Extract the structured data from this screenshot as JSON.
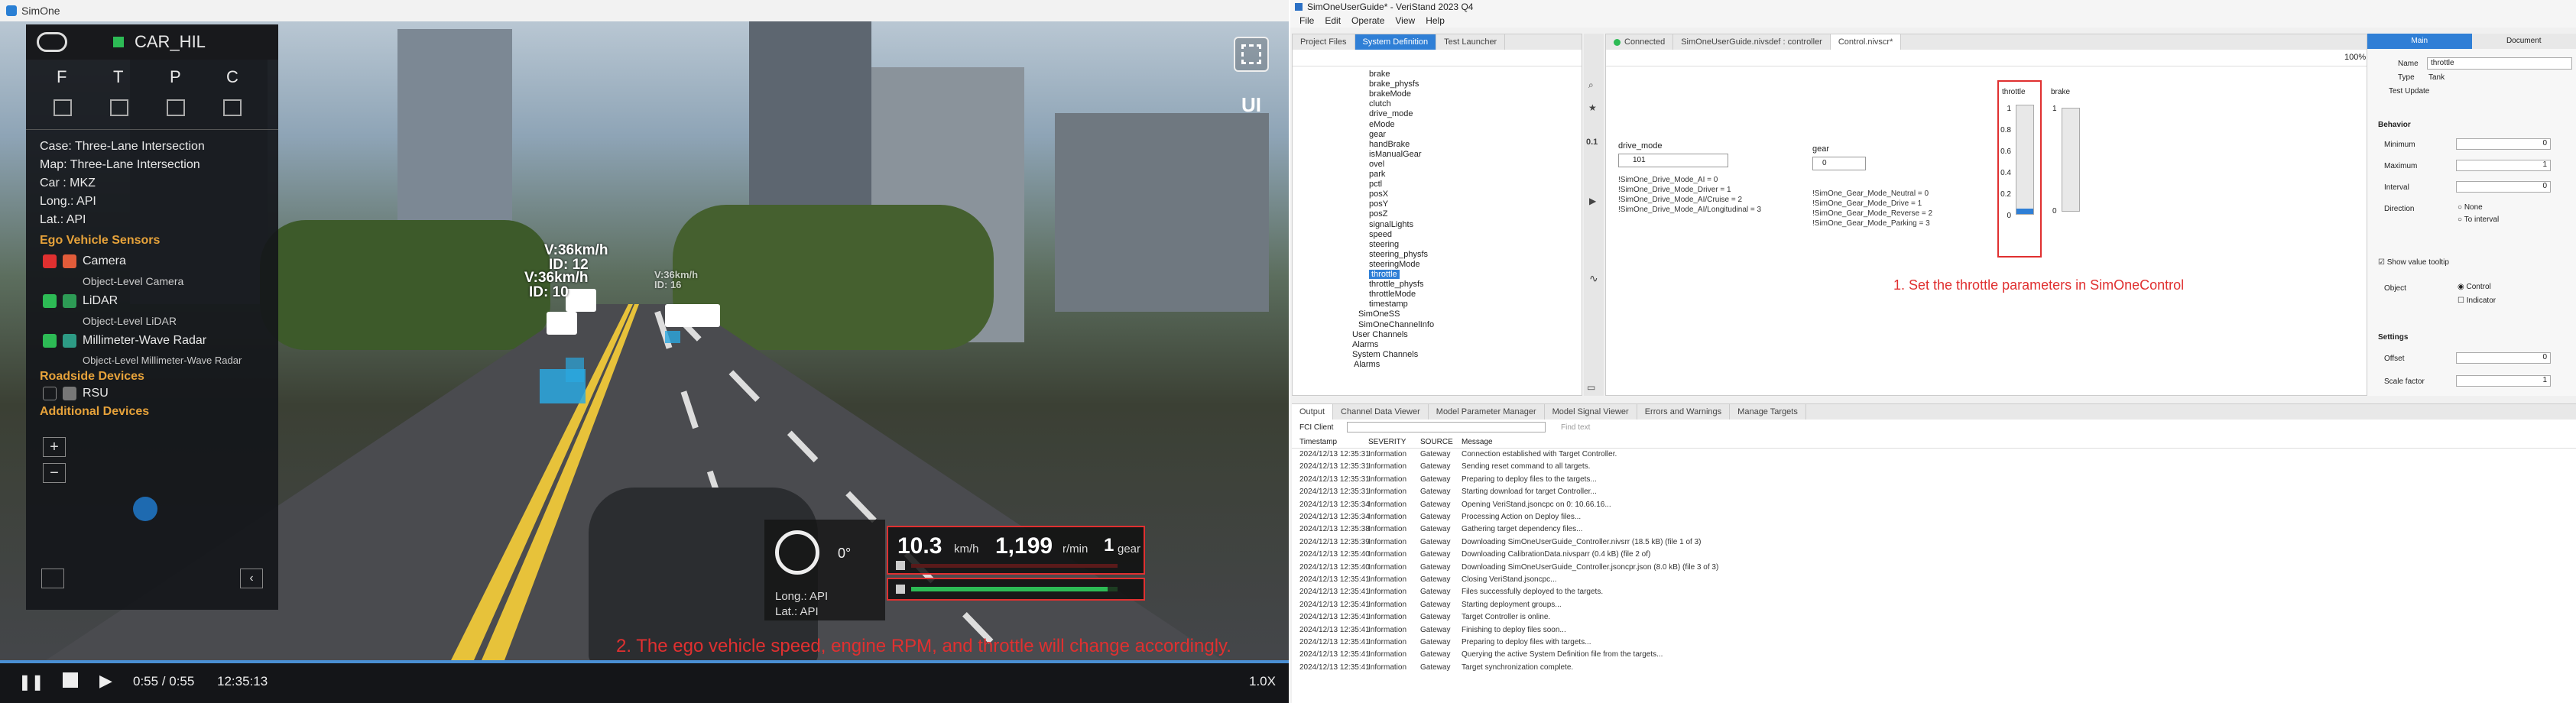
{
  "simone": {
    "app_title": "SimOne",
    "vehicle_name": "CAR_HIL",
    "modes": [
      "F",
      "T",
      "P",
      "C"
    ],
    "info": [
      {
        "key": "Case:",
        "value": "Three-Lane Intersection"
      },
      {
        "key": "Map:",
        "value": "Three-Lane Intersection"
      },
      {
        "key": "Car :",
        "value": "MKZ"
      },
      {
        "key": "Long.:",
        "value": "API"
      },
      {
        "key": "Lat.:",
        "value": "API"
      }
    ],
    "sections": {
      "ego": "Ego Vehicle Sensors",
      "roadside": "Roadside Devices",
      "additional": "Additional Devices"
    },
    "sensors": [
      {
        "name": "Camera",
        "sub": "Object-Level Camera"
      },
      {
        "name": "LiDAR",
        "sub": "Object-Level LiDAR"
      },
      {
        "name": "Millimeter-Wave Radar",
        "sub": "Object-Level Millimeter-Wave Radar"
      }
    ],
    "roadside_item": "RSU",
    "right_btn_ui": "UI",
    "car_labels": [
      {
        "line1": "V:36km/h",
        "line2": "ID: 12"
      },
      {
        "line1": "V:36km/h",
        "line2": "ID: 10"
      },
      {
        "line1": "V:36km/h",
        "line2": "ID: 16"
      }
    ],
    "dash": {
      "steer": "0°",
      "speed": "10.3",
      "speed_unit": "km/h",
      "rpm": "1,199",
      "rpm_unit": "r/min",
      "gear": "1",
      "gear_unit": "gear",
      "long": "Long.: API",
      "lat": "Lat.: API",
      "throttle_level": 0.95
    },
    "annotation": "2. The ego vehicle speed, engine RPM, and throttle will change accordingly.",
    "time": "0:55 / 0:55",
    "clock": "12:35:13",
    "speed_factor": "1.0X",
    "progress": 1.0,
    "colors": {
      "accent": "#e03030",
      "green": "#2dbb55",
      "box": "#2aa8e0"
    }
  },
  "veristand": {
    "title": "SimOneUserGuide* - VeriStand 2023 Q4",
    "menu": [
      "File",
      "Edit",
      "Operate",
      "View",
      "Help"
    ],
    "left_tabs": [
      "Project Files",
      "System Definition",
      "Test Launcher"
    ],
    "status_tabs": [
      "Connected",
      "SimOneUserGuide.nivsdef : controller",
      "Control.nivscr*"
    ],
    "zoom": "100%",
    "tree": [
      "brake",
      "brake_physfs",
      "brakeMode",
      "clutch",
      "drive_mode",
      "eMode",
      "gear",
      "handBrake",
      "isManualGear",
      "ovel",
      "park",
      "pctl",
      "posX",
      "posY",
      "posZ",
      "signalLights",
      "speed",
      "steering",
      "steering_physfs",
      "steeringMode",
      "throttle",
      "throttle_physfs",
      "throttleMode",
      "timestamp",
      "SimOneSS",
      "SimOneChannelInfo",
      "User Channels",
      "Alarms",
      "System Channels",
      "Alarms"
    ],
    "drive_mode_label": "drive_mode",
    "drive_mode_value": "101",
    "drive_mode_notes": [
      "!SimOne_Drive_Mode_AI = 0",
      "!SimOne_Drive_Mode_Driver = 1",
      "!SimOne_Drive_Mode_AI/Cruise = 2",
      "!SimOne_Drive_Mode_AI/Longitudinal = 3"
    ],
    "gear_label": "gear",
    "gear_value": "0",
    "gear_notes": [
      "!SimOne_Gear_Mode_Neutral = 0",
      "!SimOne_Gear_Mode_Drive = 1",
      "!SimOne_Gear_Mode_Reverse = 2",
      "!SimOne_Gear_Mode_Parking = 3"
    ],
    "throttle_label": "throttle",
    "brake_label": "brake",
    "ticks": [
      "1",
      "0.8",
      "0.6",
      "0.4",
      "0.2",
      "0"
    ],
    "brake_ticks": [
      "1",
      "0"
    ],
    "throttle_value": 0.05,
    "instruction": "1. Set the throttle parameters in SimOneControl",
    "props": {
      "tabs": [
        "Main",
        "Document"
      ],
      "name_label": "Name",
      "name_value": "throttle",
      "type_label": "Type",
      "type_value": "Tank",
      "test_update": "Test Update",
      "behavior": "Behavior",
      "minimum": "Minimum",
      "min_value": "0",
      "maximum": "Maximum",
      "max_value": "1",
      "interval": "Interval",
      "interval_value": "0",
      "direction": "Direction",
      "dir_none": "None",
      "dir_to": "To interval",
      "show_tooltip": "Show value tooltip",
      "object": "Object",
      "obj_control": "Control",
      "obj_indicator": "Indicator",
      "settings": "Settings",
      "offset": "Offset",
      "offset_value": "0",
      "scale": "Scale factor",
      "scale_value": "1"
    },
    "bottom_tabs": [
      "Output",
      "Channel Data Viewer",
      "Model Parameter Manager",
      "Model Signal Viewer",
      "Errors and Warnings",
      "Manage Targets"
    ],
    "fc_client": "FCI Client",
    "find": "Find text",
    "log_headers": [
      "Timestamp",
      "SEVERITY",
      "SOURCE",
      "Message"
    ],
    "logs": [
      {
        "t": "2024/12/13 12:35:31",
        "s": "Information",
        "src": "Gateway",
        "m": "Connection established with Target Controller."
      },
      {
        "t": "2024/12/13 12:35:31",
        "s": "Information",
        "src": "Gateway",
        "m": "Sending reset command to all targets."
      },
      {
        "t": "2024/12/13 12:35:31",
        "s": "Information",
        "src": "Gateway",
        "m": "Preparing to deploy files to the targets..."
      },
      {
        "t": "2024/12/13 12:35:31",
        "s": "Information",
        "src": "Gateway",
        "m": "Starting download for target Controller..."
      },
      {
        "t": "2024/12/13 12:35:34",
        "s": "Information",
        "src": "Gateway",
        "m": "Opening VeriStand.jsoncpc on 0: 10.66.16..."
      },
      {
        "t": "2024/12/13 12:35:34",
        "s": "Information",
        "src": "Gateway",
        "m": "Processing Action on Deploy files..."
      },
      {
        "t": "2024/12/13 12:35:38",
        "s": "Information",
        "src": "Gateway",
        "m": "Gathering target dependency files..."
      },
      {
        "t": "2024/12/13 12:35:39",
        "s": "Information",
        "src": "Gateway",
        "m": "Downloading SimOneUserGuide_Controller.nivsrr (18.5 kB) (file 1 of 3)"
      },
      {
        "t": "2024/12/13 12:35:40",
        "s": "Information",
        "src": "Gateway",
        "m": "Downloading CalibrationData.nivsparr (0.4 kB) (file 2 of)"
      },
      {
        "t": "2024/12/13 12:35:40",
        "s": "Information",
        "src": "Gateway",
        "m": "Downloading SimOneUserGuide_Controller.jsoncpr.json (8.0 kB) (file 3 of 3)"
      },
      {
        "t": "2024/12/13 12:35:41",
        "s": "Information",
        "src": "Gateway",
        "m": "Closing VeriStand.jsoncpc..."
      },
      {
        "t": "2024/12/13 12:35:41",
        "s": "Information",
        "src": "Gateway",
        "m": "Files successfully deployed to the targets."
      },
      {
        "t": "2024/12/13 12:35:41",
        "s": "Information",
        "src": "Gateway",
        "m": "Starting deployment groups..."
      },
      {
        "t": "2024/12/13 12:35:41",
        "s": "Information",
        "src": "Gateway",
        "m": "Target Controller is online."
      },
      {
        "t": "2024/12/13 12:35:41",
        "s": "Information",
        "src": "Gateway",
        "m": "Finishing to deploy files soon..."
      },
      {
        "t": "2024/12/13 12:35:41",
        "s": "Information",
        "src": "Gateway",
        "m": "Preparing to deploy files with targets..."
      },
      {
        "t": "2024/12/13 12:35:41",
        "s": "Information",
        "src": "Gateway",
        "m": "Querying the active System Definition file from the targets..."
      },
      {
        "t": "2024/12/13 12:35:41",
        "s": "Information",
        "src": "Gateway",
        "m": "Target synchronization complete."
      }
    ]
  }
}
